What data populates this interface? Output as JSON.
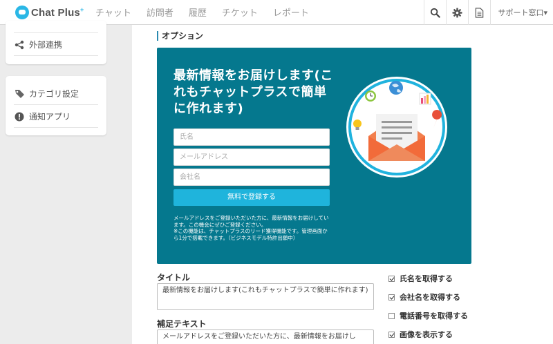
{
  "app": {
    "logo_text": "Chat Plus",
    "logo_sup": "+"
  },
  "nav": {
    "items": [
      "チャット",
      "訪問者",
      "履歴",
      "チケット",
      "レポート"
    ],
    "support_label": "サポート窓口▾"
  },
  "sidebar": {
    "items": [
      {
        "label": "外部連携",
        "icon": "share-icon"
      },
      {
        "label": "カテゴリ設定",
        "icon": "tag-icon"
      },
      {
        "label": "通知アプリ",
        "icon": "alert-icon"
      }
    ]
  },
  "main": {
    "section_title": "オプション",
    "banner": {
      "title": "最新情報をお届けします(これもチャットプラスで簡単に作れます)",
      "placeholders": [
        "氏名",
        "メールアドレス",
        "会社名"
      ],
      "button_label": "無料で登録する",
      "note": "メールアドレスをご登録いただいた方に、最新情報をお届けしています。この機会にぜひご登録ください。\n※この機能は、チャットプラスのリード獲得機能です。管理画面から1分で搭載できます。（ビジネスモデル特許出願中）"
    },
    "title_field": {
      "label": "タイトル",
      "value": "最新情報をお届けします(これもチャットプラスで簡単に作れます)"
    },
    "supplement_field": {
      "label": "補足テキスト",
      "value": "メールアドレスをご登録いただいた方に、最新情報をお届けし"
    },
    "options": [
      {
        "label": "氏名を取得する",
        "checked": true
      },
      {
        "label": "会社名を取得する",
        "checked": true
      },
      {
        "label": "電話番号を取得する",
        "checked": false
      },
      {
        "label": "画像を表示する",
        "checked": true
      }
    ]
  },
  "colors": {
    "brand": "#2ab7e6",
    "banner_bg": "#05788e",
    "button": "#1fb4dc"
  }
}
